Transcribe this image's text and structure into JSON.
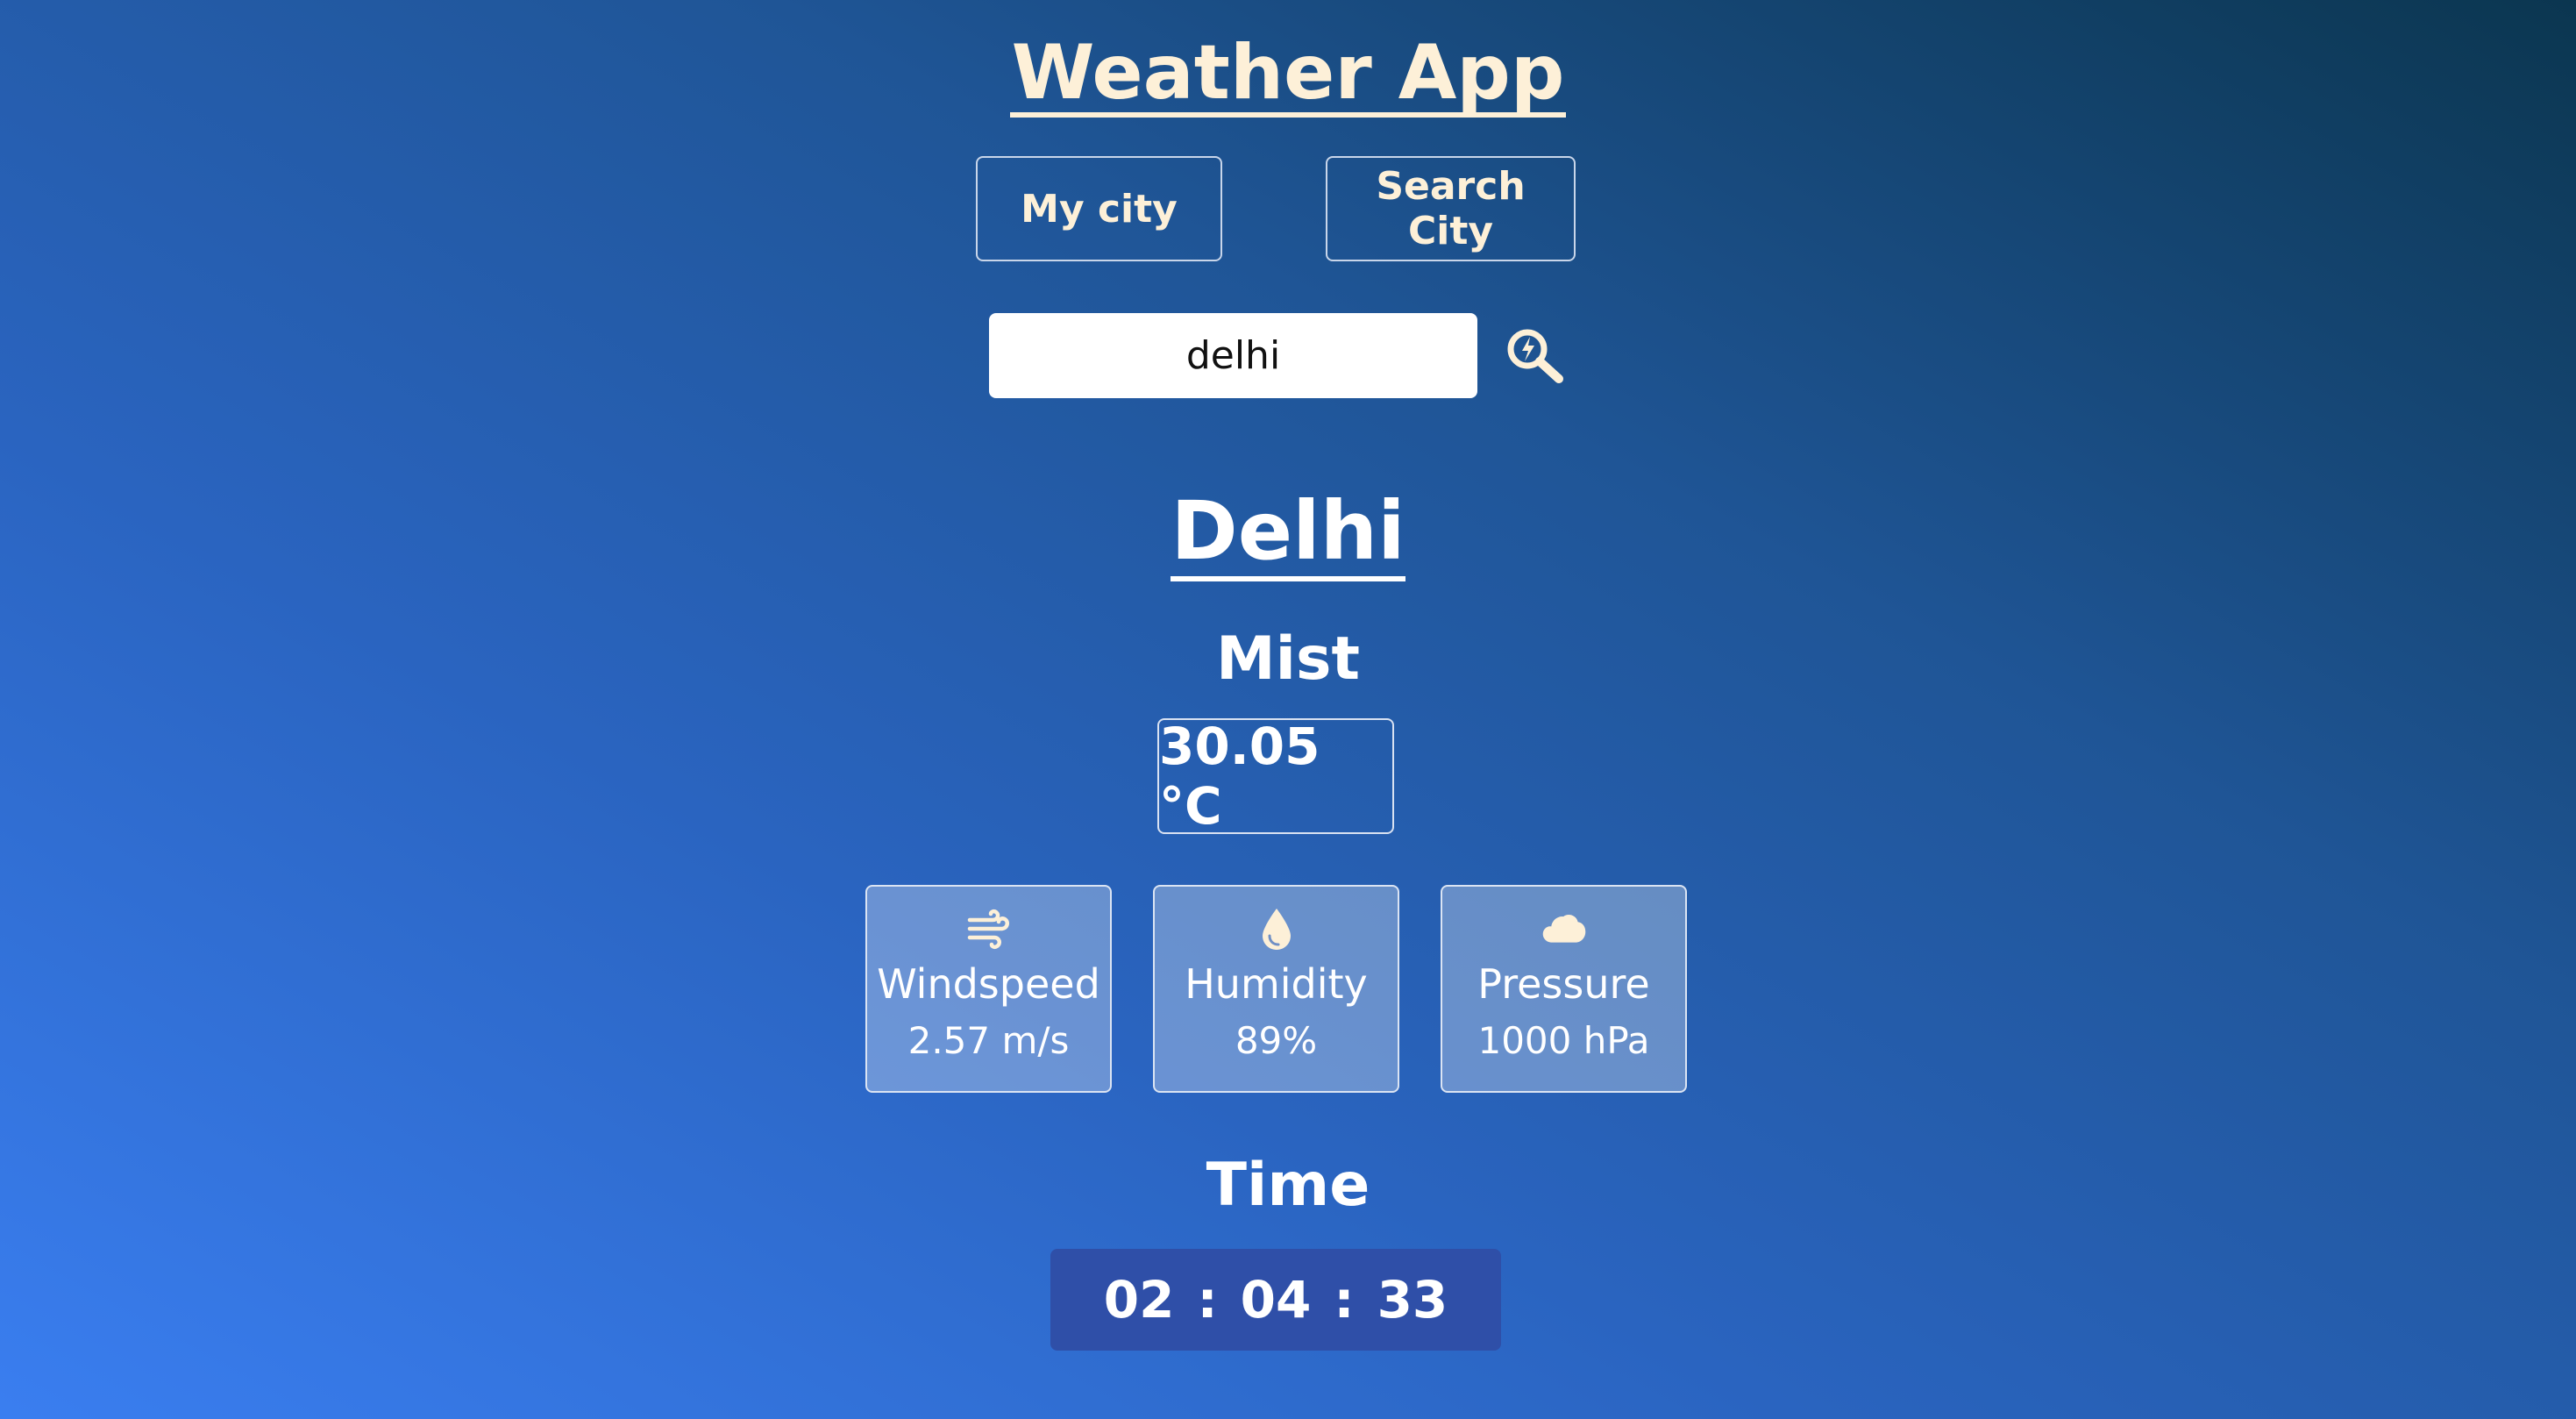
{
  "app": {
    "title": "Weather App"
  },
  "nav": {
    "my_city_label": "My city",
    "search_city_label": "Search City"
  },
  "search": {
    "value": "delhi"
  },
  "weather": {
    "city": "Delhi",
    "condition": "Mist",
    "temperature": "30.05 °C",
    "stats": [
      {
        "icon": "wind-icon",
        "label": "Windspeed",
        "value": "2.57 m/s"
      },
      {
        "icon": "water-drop-icon",
        "label": "Humidity",
        "value": "89%"
      },
      {
        "icon": "cloud-icon",
        "label": "Pressure",
        "value": "1000 hPa"
      }
    ]
  },
  "time": {
    "heading": "Time",
    "hours": "02",
    "minutes": "04",
    "seconds": "33",
    "separator": ":"
  },
  "colors": {
    "accent_cream": "#fdf0d8",
    "clock_bg": "#2f4fa8",
    "gradient_start": "#3a7ef0",
    "gradient_end": "#0b3650"
  }
}
